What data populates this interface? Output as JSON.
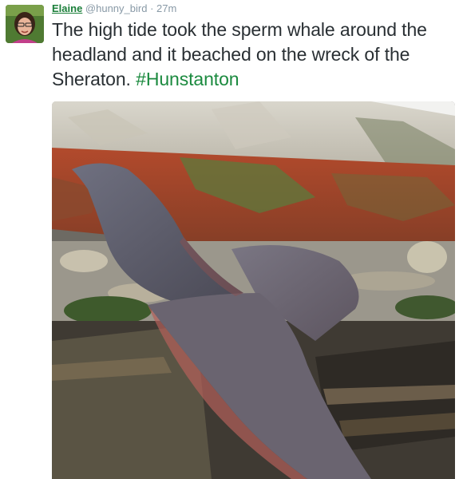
{
  "author": {
    "name": "Elaine",
    "handle": "@hunny_bird",
    "separator": "·",
    "time": "27m",
    "avatar_icon": "profile-photo"
  },
  "tweet": {
    "text": "The high tide took the sperm whale around the headland and it beached on the wreck of the Sheraton. ",
    "hashtag": "#Hunstanton"
  },
  "colors": {
    "name": "#1b7f3a",
    "hashtag": "#1b8a3f",
    "meta": "#8899a6",
    "text": "#292f33"
  },
  "media": {
    "icon": "photo-whale-beached"
  }
}
